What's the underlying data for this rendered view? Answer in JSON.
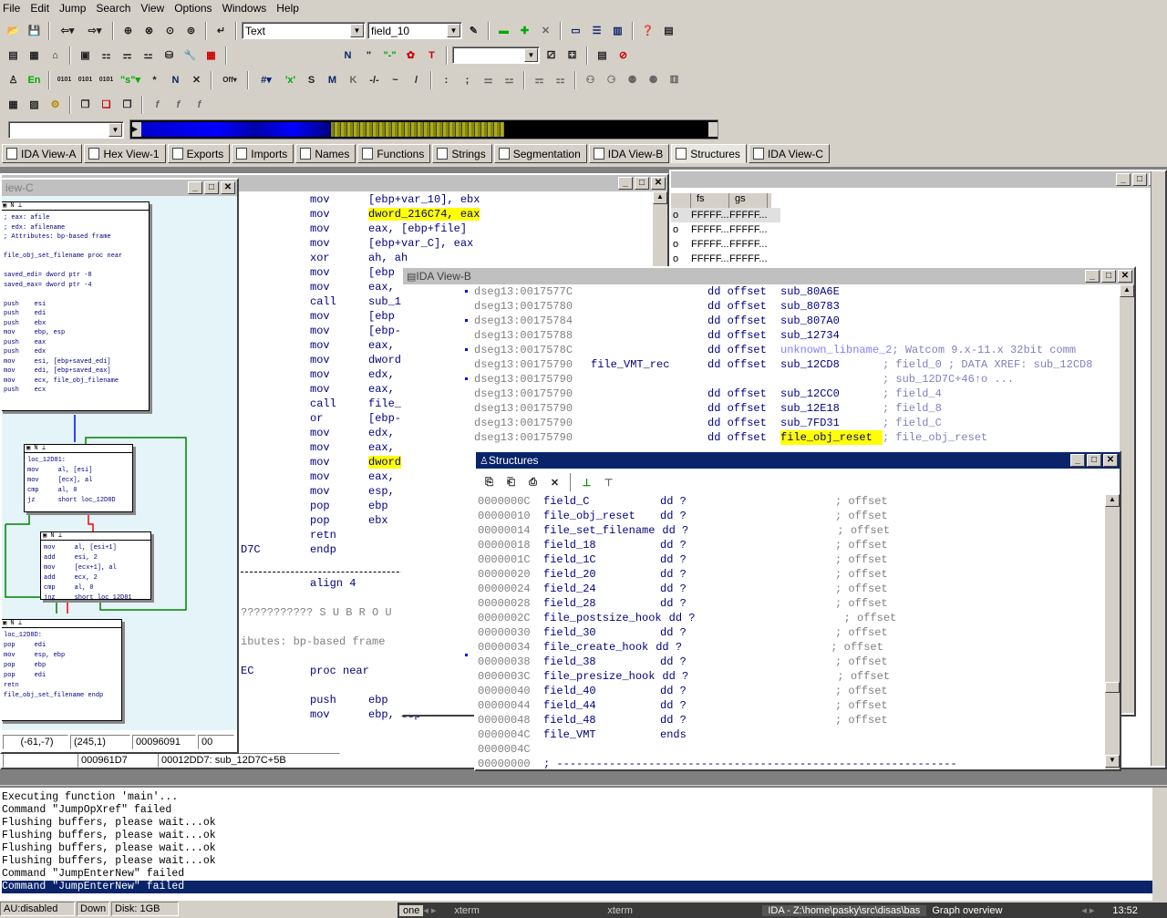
{
  "menu": [
    "File",
    "Edit",
    "Jump",
    "Search",
    "View",
    "Options",
    "Windows",
    "Help"
  ],
  "toolbar": {
    "combo_text": "Text",
    "combo_field": "field_10",
    "nav_combo": ""
  },
  "tabs": [
    {
      "label": "IDA View-A",
      "icon": "ida-view-icon"
    },
    {
      "label": "Hex View-1",
      "icon": "hex-view-icon"
    },
    {
      "label": "Exports",
      "icon": "exports-icon"
    },
    {
      "label": "Imports",
      "icon": "imports-icon"
    },
    {
      "label": "Names",
      "icon": "names-icon"
    },
    {
      "label": "Functions",
      "icon": "functions-icon"
    },
    {
      "label": "Strings",
      "icon": "strings-icon"
    },
    {
      "label": "Segmentation",
      "icon": "segmentation-icon"
    },
    {
      "label": "IDA View-B",
      "icon": "ida-view-icon"
    },
    {
      "label": "Structures",
      "icon": "structures-icon"
    },
    {
      "label": "IDA View-C",
      "icon": "ida-view-icon"
    }
  ],
  "view_c": {
    "title": "iew-C",
    "status": [
      "(-61,-7)",
      "(245,1)",
      "00096091",
      "00"
    ],
    "nodes": [
      {
        "lines": [
          "; eax: afile",
          "; edx: afilename",
          "; Attributes: bp-based frame",
          "",
          "file_obj_set_filename proc near",
          "",
          "saved_edi= dword ptr -8",
          "saved_eax= dword ptr -4",
          "",
          "push    esi",
          "push    edi",
          "push    ebx",
          "mov     ebp, esp",
          "push    eax",
          "push    edx",
          "mov     esi, [ebp+saved_edi]",
          "mov     edi, [ebp+saved_eax]",
          "mov     ecx, file_obj_filename",
          "push    ecx"
        ]
      },
      {
        "lines": [
          "loc_12D81:",
          "mov     al, [esi]",
          "mov     [ecx], al",
          "cmp     al, 0",
          "jz      short loc_12D8D"
        ]
      },
      {
        "lines": [
          "mov     al, [esi+1]",
          "add     esi, 2",
          "mov     [ecx+1], al",
          "add     ecx, 2",
          "cmp     al, 0",
          "jnz     short loc_12D81"
        ]
      },
      {
        "lines": [
          "loc_12D8D:",
          "pop     edi",
          "mov     esp, ebp",
          "pop     ebp",
          "pop     edi",
          "retn",
          "file_obj_set_filename endp"
        ]
      }
    ]
  },
  "view_a": {
    "lines": [
      {
        "mn": "mov",
        "op": "[ebp+var_10], ebx"
      },
      {
        "mn": "mov",
        "op": "dword_216C74, eax",
        "hl": true
      },
      {
        "mn": "mov",
        "op": "eax, [ebp+file]"
      },
      {
        "mn": "mov",
        "op": "[ebp+var_C], eax"
      },
      {
        "mn": "xor",
        "op": "ah, ah"
      },
      {
        "mn": "mov",
        "op": "[ebp"
      },
      {
        "mn": "mov",
        "op": "eax,"
      },
      {
        "mn": "call",
        "op": "sub_1"
      },
      {
        "mn": "mov",
        "op": "[ebp"
      },
      {
        "mn": "mov",
        "op": "[ebp-"
      },
      {
        "mn": "mov",
        "op": "eax,"
      },
      {
        "mn": "mov",
        "op": "dword"
      },
      {
        "mn": "mov",
        "op": "edx,"
      },
      {
        "mn": "mov",
        "op": "eax,"
      },
      {
        "mn": "call",
        "op": "file_"
      },
      {
        "mn": "or",
        "op": "[ebp-"
      },
      {
        "mn": "mov",
        "op": "edx,"
      },
      {
        "mn": "mov",
        "op": "eax,"
      },
      {
        "mn": "mov",
        "op": "dword",
        "hl": true
      },
      {
        "mn": "mov",
        "op": "eax,"
      },
      {
        "mn": "mov",
        "op": "esp,"
      },
      {
        "mn": "pop",
        "op": "ebp"
      },
      {
        "mn": "pop",
        "op": "ebx"
      },
      {
        "mn": "retn",
        "op": ""
      }
    ],
    "endp_addr": "D7C",
    "endp": "endp",
    "align": "align 4",
    "subr": "??????????? S U B R O U",
    "attrs": "ibutes: bp-based frame",
    "proc_addr": "EC",
    "proc": "proc near",
    "push": {
      "mn": "push",
      "op": "ebp"
    },
    "mov2": {
      "mn": "mov",
      "op": "ebp, esp"
    },
    "status": [
      "000961D7",
      "00012DD7: sub_12D7C+5B"
    ]
  },
  "hex_view": {
    "cols": [
      "fs",
      "gs"
    ],
    "rows": [
      [
        "FFFFF...",
        "FFFFF..."
      ],
      [
        "FFFFF...",
        "FFFFF..."
      ],
      [
        "FFFFF...",
        "FFFFF..."
      ],
      [
        "FFFFF...",
        "FFFFF..."
      ]
    ]
  },
  "view_b": {
    "title": "IDA View-B",
    "lines": [
      {
        "addr": "dseg13:0017577C",
        "label": "",
        "dir": "dd offset",
        "target": "sub_80A6E",
        "cmt": ""
      },
      {
        "addr": "dseg13:00175780",
        "label": "",
        "dir": "dd offset",
        "target": "sub_80783",
        "cmt": ""
      },
      {
        "addr": "dseg13:00175784",
        "label": "",
        "dir": "dd offset",
        "target": "sub_807A0",
        "cmt": ""
      },
      {
        "addr": "dseg13:00175788",
        "label": "",
        "dir": "dd offset",
        "target": "sub_12734",
        "cmt": ""
      },
      {
        "addr": "dseg13:0017578C",
        "label": "",
        "dir": "dd offset",
        "target": "unknown_libname_2",
        "cmt": "; Watcom 9.x-11.x 32bit comm"
      },
      {
        "addr": "dseg13:00175790",
        "label": "file_VMT_rec",
        "dir": "dd offset",
        "target": "sub_12CD8",
        "cmt": "; field_0 ; DATA XREF: sub_12CD8"
      },
      {
        "addr": "dseg13:00175790",
        "label": "",
        "dir": "",
        "target": "",
        "cmt": "; sub_12D7C+46↑o ..."
      },
      {
        "addr": "dseg13:00175790",
        "label": "",
        "dir": "dd offset",
        "target": "sub_12CC0",
        "cmt": "; field_4"
      },
      {
        "addr": "dseg13:00175790",
        "label": "",
        "dir": "dd offset",
        "target": "sub_12E18",
        "cmt": "; field_8"
      },
      {
        "addr": "dseg13:00175790",
        "label": "",
        "dir": "dd offset",
        "target": "sub_7FD31",
        "cmt": "; field_C"
      },
      {
        "addr": "dseg13:00175790",
        "label": "",
        "dir": "dd offset",
        "target": "file_obj_reset",
        "cmt": "; file_obj_reset"
      }
    ]
  },
  "structures": {
    "title": "Structures",
    "lines": [
      {
        "off": "0000000C",
        "name": "field_C",
        "type": "dd ?",
        "cmt": "; offset"
      },
      {
        "off": "00000010",
        "name": "file_obj_reset",
        "type": "dd ?",
        "cmt": "; offset"
      },
      {
        "off": "00000014",
        "name": "file_set_filename",
        "type": "dd ?",
        "cmt": "; offset"
      },
      {
        "off": "00000018",
        "name": "field_18",
        "type": "dd ?",
        "cmt": "; offset"
      },
      {
        "off": "0000001C",
        "name": "field_1C",
        "type": "dd ?",
        "cmt": "; offset"
      },
      {
        "off": "00000020",
        "name": "field_20",
        "type": "dd ?",
        "cmt": "; offset"
      },
      {
        "off": "00000024",
        "name": "field_24",
        "type": "dd ?",
        "cmt": "; offset"
      },
      {
        "off": "00000028",
        "name": "field_28",
        "type": "dd ?",
        "cmt": "; offset"
      },
      {
        "off": "0000002C",
        "name": "file_postsize_hook",
        "type": "dd ?",
        "cmt": "; offset"
      },
      {
        "off": "00000030",
        "name": "field_30",
        "type": "dd ?",
        "cmt": "; offset"
      },
      {
        "off": "00000034",
        "name": "file_create_hook",
        "type": "dd ?",
        "cmt": "; offset"
      },
      {
        "off": "00000038",
        "name": "field_38",
        "type": "dd ?",
        "cmt": "; offset"
      },
      {
        "off": "0000003C",
        "name": "file_presize_hook",
        "type": "dd ?",
        "cmt": "; offset"
      },
      {
        "off": "00000040",
        "name": "field_40",
        "type": "dd ?",
        "cmt": "; offset"
      },
      {
        "off": "00000044",
        "name": "field_44",
        "type": "dd ?",
        "cmt": "; offset"
      },
      {
        "off": "00000048",
        "name": "field_48",
        "type": "dd ?",
        "cmt": "; offset"
      },
      {
        "off": "0000004C",
        "name": "file_VMT",
        "type": "ends",
        "cmt": ""
      },
      {
        "off": "0000004C",
        "name": "",
        "type": "",
        "cmt": ""
      },
      {
        "off": "00000000",
        "name": "; -------------------------------------------------------------",
        "type": "",
        "cmt": ""
      }
    ]
  },
  "output": {
    "lines": [
      "Executing function 'main'...",
      "Command \"JumpOpXref\" failed",
      "Flushing buffers, please wait...ok",
      "Flushing buffers, please wait...ok",
      "Flushing buffers, please wait...ok",
      "Flushing buffers, please wait...ok",
      "Command \"JumpEnterNew\" failed",
      "Command \"JumpEnterNew\" failed"
    ]
  },
  "statusbar": {
    "au": "AU:disabled",
    "dir": "Down",
    "disk": "Disk: 1GB"
  },
  "taskbar": {
    "workspace": "one",
    "items": [
      "xterm",
      "xterm",
      "IDA - Z:\\home\\pasky\\src\\disas\\bas",
      "Graph overview"
    ],
    "clock": "13:52"
  },
  "colors": {
    "accent": "#0a246a",
    "highlight": "#ffff00",
    "code": "#000080"
  }
}
